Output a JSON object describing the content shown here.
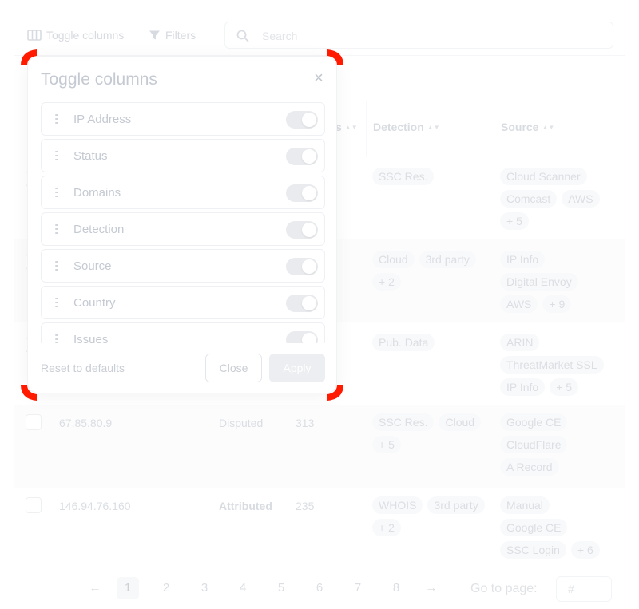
{
  "toolbar": {
    "toggle_columns_label": "Toggle columns",
    "filters_label": "Filters",
    "search_placeholder": "Search"
  },
  "table": {
    "headers": {
      "status_partial": "s",
      "detection": "Detection",
      "source": "Source",
      "sort_glyph": "▲▼"
    },
    "rows": [
      {
        "ip": "",
        "status": "",
        "domains": "",
        "detection": [
          "SSC Res."
        ],
        "source": [
          "Cloud Scanner",
          "Comcast",
          "AWS",
          "+ 5"
        ]
      },
      {
        "ip": "",
        "status": "",
        "domains": "",
        "detection": [
          "Cloud",
          "3rd party",
          "+ 2"
        ],
        "source": [
          "IP Info",
          "Digital Envoy",
          "AWS",
          "+ 9"
        ]
      },
      {
        "ip": "",
        "status": "",
        "domains": "",
        "detection": [
          "Pub. Data"
        ],
        "source": [
          "ARIN",
          "ThreatMarket SSL",
          "IP Info",
          "+ 5"
        ]
      },
      {
        "ip": "67.85.80.9",
        "status": "Disputed",
        "domains": "313",
        "detection": [
          "SSC Res.",
          "Cloud",
          "+ 5"
        ],
        "source": [
          "Google CE",
          "CloudFlare",
          "A Record"
        ]
      },
      {
        "ip": "146.94.76.160",
        "status": "Attributed",
        "domains": "235",
        "detection": [
          "WHOIS",
          "3rd party",
          "+ 2"
        ],
        "source": [
          "Manual",
          "Google CE",
          "SSC Login",
          "+ 6"
        ]
      }
    ]
  },
  "pagination": {
    "prev": "←",
    "next": "→",
    "pages": [
      "1",
      "2",
      "3",
      "4",
      "5",
      "6",
      "7",
      "8"
    ],
    "current": "1",
    "goto_label": "Go to page:",
    "goto_placeholder": "#"
  },
  "modal": {
    "title": "Toggle columns",
    "close_glyph": "×",
    "columns": [
      {
        "label": "IP Address",
        "enabled": true
      },
      {
        "label": "Status",
        "enabled": true
      },
      {
        "label": "Domains",
        "enabled": true
      },
      {
        "label": "Detection",
        "enabled": true
      },
      {
        "label": "Source",
        "enabled": true
      },
      {
        "label": "Country",
        "enabled": true
      },
      {
        "label": "Issues",
        "enabled": true
      }
    ],
    "reset_label": "Reset to defaults",
    "close_label": "Close",
    "apply_label": "Apply"
  },
  "colors": {
    "marker_red": "#ff1a00",
    "marker_yellow": "#ffd400"
  }
}
